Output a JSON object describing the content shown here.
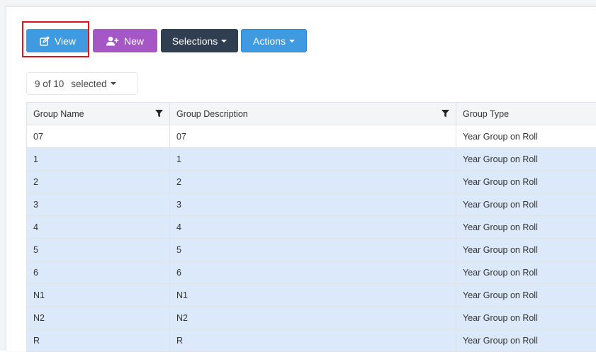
{
  "toolbar": {
    "view_label": "View",
    "view_icon": "edit-icon",
    "new_label": "New",
    "new_icon": "add-user-icon",
    "selections_label": "Selections",
    "actions_label": "Actions"
  },
  "selection": {
    "count_text": "9 of 10",
    "selected_text": "selected"
  },
  "colors": {
    "primary": "#3f9ae0",
    "purple": "#a557c6",
    "dark": "#2f3e50",
    "highlight": "#e0131b",
    "row_selected": "#dbe9fb"
  },
  "table": {
    "columns": [
      "Group Name",
      "Group Description",
      "Group Type"
    ],
    "rows": [
      {
        "name": "07",
        "description": "07",
        "type": "Year Group on Roll",
        "selected": false
      },
      {
        "name": "1",
        "description": "1",
        "type": "Year Group on Roll",
        "selected": true
      },
      {
        "name": "2",
        "description": "2",
        "type": "Year Group on Roll",
        "selected": true
      },
      {
        "name": "3",
        "description": "3",
        "type": "Year Group on Roll",
        "selected": true
      },
      {
        "name": "4",
        "description": "4",
        "type": "Year Group on Roll",
        "selected": true
      },
      {
        "name": "5",
        "description": "5",
        "type": "Year Group on Roll",
        "selected": true
      },
      {
        "name": "6",
        "description": "6",
        "type": "Year Group on Roll",
        "selected": true
      },
      {
        "name": "N1",
        "description": "N1",
        "type": "Year Group on Roll",
        "selected": true
      },
      {
        "name": "N2",
        "description": "N2",
        "type": "Year Group on Roll",
        "selected": true
      },
      {
        "name": "R",
        "description": "R",
        "type": "Year Group on Roll",
        "selected": true
      }
    ]
  }
}
